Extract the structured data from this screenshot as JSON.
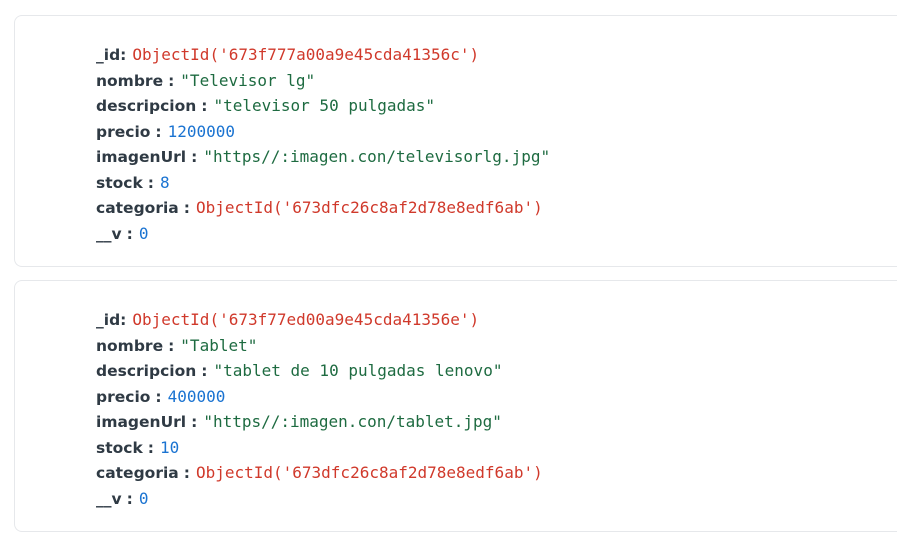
{
  "colors": {
    "key": "#2f3a44",
    "objectid": "#d0392b",
    "string": "#1e6b41",
    "number": "#1a73d1",
    "card_border": "#e6e8eb"
  },
  "documents": [
    {
      "fields": [
        {
          "key": "_id",
          "colon": ":",
          "value": "ObjectId('673f777a00a9e45cda41356c')",
          "type": "objectid"
        },
        {
          "key": "nombre",
          "colon": ":",
          "value": "\"Televisor lg\"",
          "type": "string"
        },
        {
          "key": "descripcion",
          "colon": ":",
          "value": "\"televisor 50 pulgadas\"",
          "type": "string"
        },
        {
          "key": "precio",
          "colon": ":",
          "value": "1200000",
          "type": "number"
        },
        {
          "key": "imagenUrl",
          "colon": ":",
          "value": "\"https//:imagen.con/televisorlg.jpg\"",
          "type": "string"
        },
        {
          "key": "stock",
          "colon": ":",
          "value": "8",
          "type": "number"
        },
        {
          "key": "categoria",
          "colon": ":",
          "value": "ObjectId('673dfc26c8af2d78e8edf6ab')",
          "type": "objectid"
        },
        {
          "key": "__v",
          "colon": ":",
          "value": "0",
          "type": "number"
        }
      ]
    },
    {
      "fields": [
        {
          "key": "_id",
          "colon": ":",
          "value": "ObjectId('673f77ed00a9e45cda41356e')",
          "type": "objectid"
        },
        {
          "key": "nombre",
          "colon": ":",
          "value": "\"Tablet\"",
          "type": "string"
        },
        {
          "key": "descripcion",
          "colon": ":",
          "value": "\"tablet de 10 pulgadas lenovo\"",
          "type": "string"
        },
        {
          "key": "precio",
          "colon": ":",
          "value": "400000",
          "type": "number"
        },
        {
          "key": "imagenUrl",
          "colon": ":",
          "value": "\"https//:imagen.con/tablet.jpg\"",
          "type": "string"
        },
        {
          "key": "stock",
          "colon": ":",
          "value": "10",
          "type": "number"
        },
        {
          "key": "categoria",
          "colon": ":",
          "value": "ObjectId('673dfc26c8af2d78e8edf6ab')",
          "type": "objectid"
        },
        {
          "key": "__v",
          "colon": ":",
          "value": "0",
          "type": "number"
        }
      ]
    }
  ]
}
